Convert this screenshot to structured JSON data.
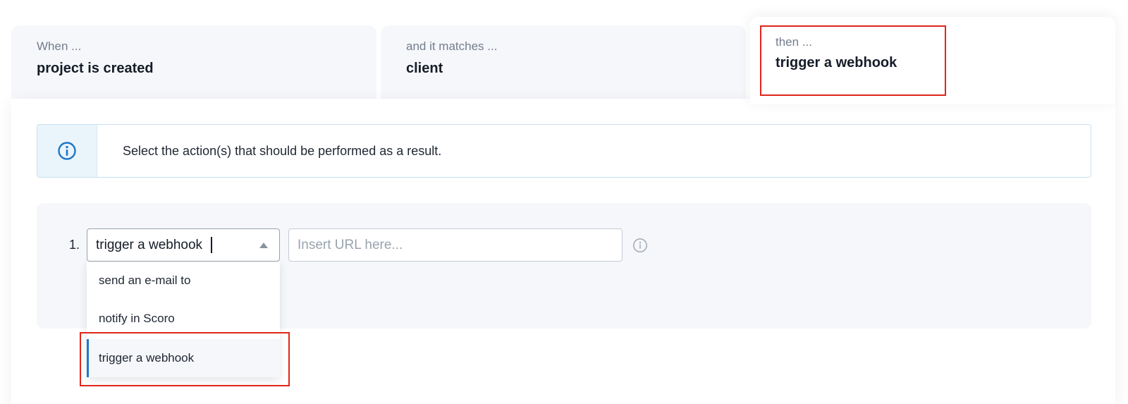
{
  "steps": [
    {
      "kicker": "When ...",
      "value": "project is created"
    },
    {
      "kicker": "and it matches ...",
      "value": "client"
    },
    {
      "kicker": "then ...",
      "value": "trigger a webhook"
    }
  ],
  "info": {
    "icon": "info-icon",
    "text": "Select the action(s) that should be performed as a result."
  },
  "action": {
    "number": "1.",
    "selected": "trigger a webhook",
    "url_placeholder": "Insert URL here...",
    "options": [
      "send an e-mail to",
      "notify in Scoro",
      "trigger a webhook"
    ]
  },
  "colors": {
    "highlight": "#e0261a",
    "accent": "#1d78c9",
    "panel_bg": "#f5f7fa"
  }
}
